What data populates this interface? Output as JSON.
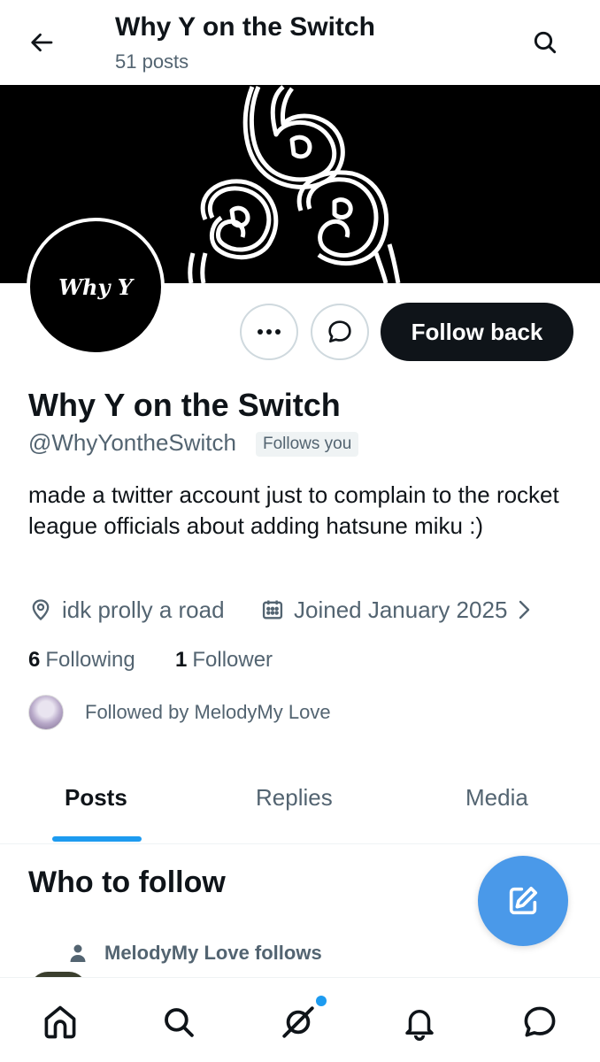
{
  "header": {
    "title": "Why Y on the Switch",
    "post_count": "51 posts"
  },
  "profile": {
    "avatar_text": "Why Y",
    "display_name": "Why Y on the Switch",
    "handle": "@WhyYontheSwitch",
    "follows_you_badge": "Follows you",
    "bio": "made a twitter account just to complain to the rocket league officials about adding hatsune miku :)",
    "location": "idk prolly a road",
    "joined": "Joined January 2025",
    "following_count": "6",
    "following_label": "Following",
    "followers_count": "1",
    "followers_label": "Follower",
    "followed_by": "Followed by MelodyMy Love"
  },
  "actions": {
    "follow_back_label": "Follow back"
  },
  "tabs": [
    {
      "label": "Posts",
      "active": true
    },
    {
      "label": "Replies",
      "active": false
    },
    {
      "label": "Media",
      "active": false
    }
  ],
  "who_to_follow": {
    "title": "Who to follow",
    "context": "MelodyMy Love follows"
  },
  "icons": {
    "back": "arrow-left-icon",
    "search": "search-icon",
    "more": "more-icon",
    "message": "message-icon",
    "location": "location-pin-icon",
    "calendar": "calendar-icon",
    "compose": "compose-icon",
    "home": "home-icon",
    "grok": "grok-icon",
    "notifications": "bell-icon",
    "messages": "messages-icon"
  },
  "colors": {
    "accent": "#1d9bf0",
    "fab": "#4a99e9",
    "text_primary": "#0f1419",
    "text_secondary": "#536471"
  }
}
